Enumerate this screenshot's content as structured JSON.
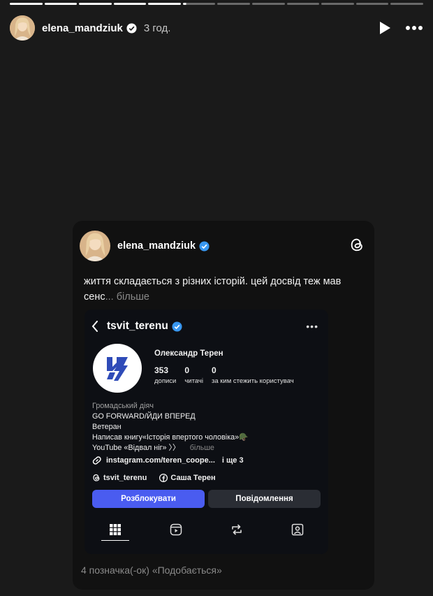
{
  "story": {
    "progress": {
      "segments": 12,
      "completed": 5,
      "current_fraction": 0.1
    },
    "username": "elena_mandziuk",
    "time": "3 год.",
    "avatar_icon": "profile-photo",
    "play_icon": "play-icon",
    "more_icon": "more-icon"
  },
  "card": {
    "username": "elena_mandziuk",
    "app_icon": "threads-icon",
    "text": "життя складається з різних історій. цей досвід теж мав сенс",
    "ellipsis": "...",
    "more": " більше",
    "likes": "4 позначка(-ок) «Подобається»"
  },
  "profile": {
    "handle": "tsvit_terenu",
    "name": "Олександр Терен",
    "stats": [
      {
        "num": "353",
        "label": "дописи"
      },
      {
        "num": "0",
        "label": "читачі"
      },
      {
        "num": "0",
        "label": "за ким стежить користувач"
      }
    ],
    "bio": {
      "category": "Громадський діяч",
      "lines": [
        "GO FORWARD/ЙДИ ВПЕРЕД",
        "Ветеран",
        "Написав книгу«Історія впертого чоловіка»🪖",
        "YouTube «Відвал ніг» 〉〉"
      ],
      "more": "більше"
    },
    "link": "instagram.com/teren_coope...",
    "link_more": "і ще 3",
    "threads_handle": "tsvit_terenu",
    "facebook_name": "Саша Терен",
    "buttons": {
      "unblock": "Розблокувати",
      "message": "Повідомлення"
    },
    "tabs": [
      "grid-icon",
      "reels-icon",
      "reposts-icon",
      "tagged-icon"
    ]
  },
  "colors": {
    "accent": "#4a5cf0",
    "verified": "#3897f0",
    "background": "#1a1a1a",
    "card": "#111111"
  }
}
